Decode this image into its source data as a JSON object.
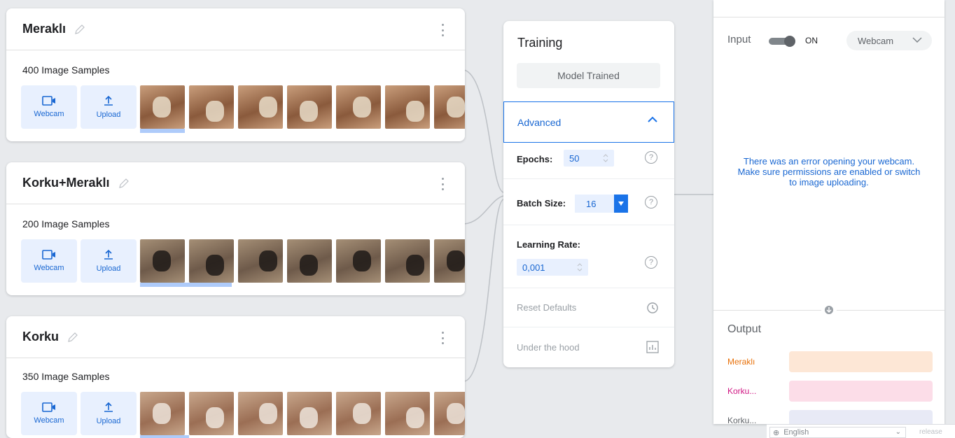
{
  "classes": [
    {
      "name": "Meraklı",
      "samples": "400 Image Samples",
      "webcam_label": "Webcam",
      "upload_label": "Upload",
      "thumb_palette": [
        "#8a5a3c",
        "#c99e7c",
        "#e8dcc8"
      ]
    },
    {
      "name": "Korku+Meraklı",
      "samples": "200 Image Samples",
      "webcam_label": "Webcam",
      "upload_label": "Upload",
      "thumb_palette": [
        "#6e5a4a",
        "#a58f76",
        "#1e1a18"
      ]
    },
    {
      "name": "Korku",
      "samples": "350 Image Samples",
      "webcam_label": "Webcam",
      "upload_label": "Upload",
      "thumb_palette": [
        "#9b6e54",
        "#c8a78c",
        "#ede4da"
      ]
    }
  ],
  "training": {
    "title": "Training",
    "model_status": "Model Trained",
    "advanced_label": "Advanced",
    "epochs_label": "Epochs:",
    "epochs_value": "50",
    "batch_label": "Batch Size:",
    "batch_value": "16",
    "lr_label": "Learning Rate:",
    "lr_value": "0,001",
    "help_glyph": "?",
    "reset_label": "Reset Defaults",
    "hood_label": "Under the hood"
  },
  "preview": {
    "input_label": "Input",
    "toggle_state": "ON",
    "source_select": "Webcam",
    "error_message": "There was an error opening your webcam. Make sure permissions are enabled or switch to image uploading.",
    "output_label": "Output",
    "outputs": [
      {
        "name": "Meraklı",
        "text_color": "#e8710a",
        "bar_color": "#fde7d6"
      },
      {
        "name": "Korku...",
        "text_color": "#d01884",
        "bar_color": "#fcdde8"
      },
      {
        "name": "Korku...",
        "text_color": "#5f6368",
        "bar_color": "#e8eaf6"
      }
    ]
  },
  "footer": {
    "language": "English",
    "release": "release"
  },
  "colors": {
    "accent_blue": "#1a73e8",
    "chip_blue": "#e8f0fe",
    "selection_blue": "#aecbfa"
  }
}
